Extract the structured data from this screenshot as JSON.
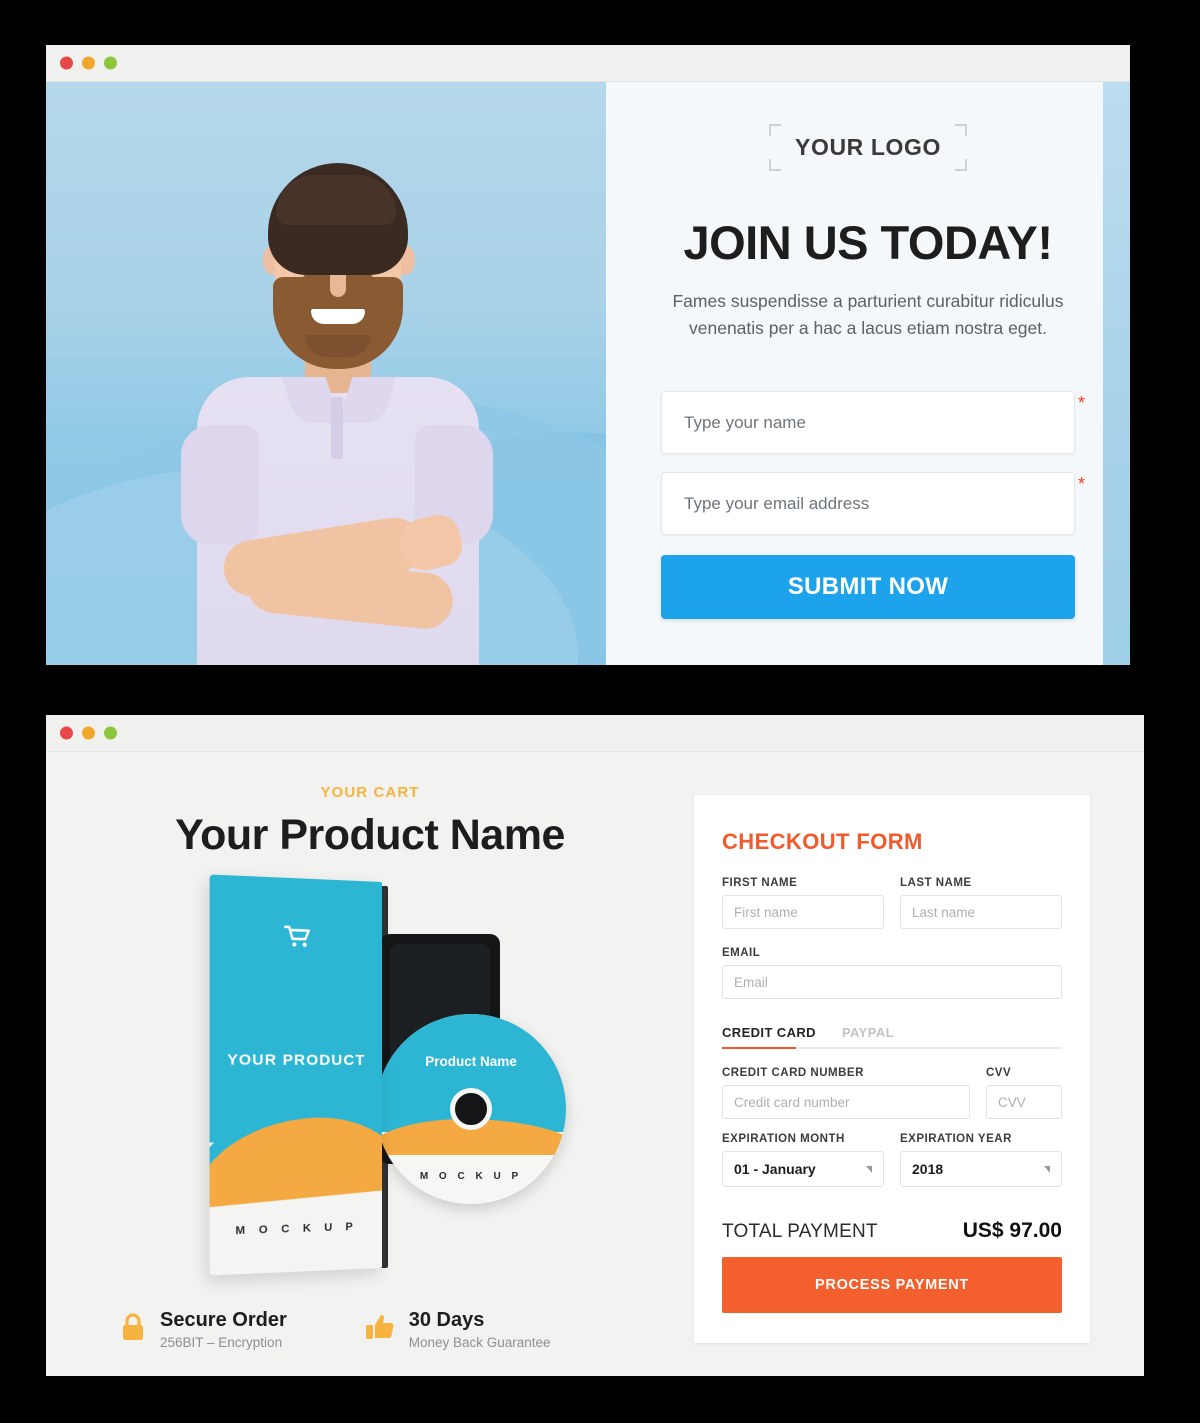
{
  "windows": {
    "top": {
      "traffic_lights": [
        "close",
        "minimize",
        "maximize"
      ],
      "hero": {
        "alt": "smiling bearded man in lavender polo shirt with arms crossed on light blue background"
      },
      "logo_placeholder": "YOUR LOGO",
      "headline": "JOIN US TODAY!",
      "subheadline": "Fames suspendisse a parturient curabitur ridiculus venenatis per a hac a lacus etiam nostra eget.",
      "form": {
        "fields": [
          {
            "name": "name",
            "placeholder": "Type your name",
            "required_mark": "*"
          },
          {
            "name": "email",
            "placeholder": "Type your email address",
            "required_mark": "*"
          }
        ],
        "submit_label": "SUBMIT NOW",
        "submit_color": "#1ca3ec"
      }
    },
    "bottom": {
      "traffic_lights": [
        "close",
        "minimize",
        "maximize"
      ],
      "cart": {
        "eyebrow": "YOUR CART",
        "eyebrow_color": "#f6b33f",
        "product_title": "Your Product Name",
        "mockup": {
          "box_front_label": "YOUR PRODUCT",
          "box_front_footer": "M O C K U P",
          "box_icon": "shopping-cart-icon",
          "disc_label": "Product Name",
          "disc_footer": "M O C K U P",
          "teal": "#2cb6d4",
          "orange": "#f5a942"
        },
        "badges": [
          {
            "icon": "lock-icon",
            "title": "Secure Order",
            "subtitle": "256BIT – Encryption"
          },
          {
            "icon": "thumbs-up-icon",
            "title": "30 Days",
            "subtitle": "Money Back Guarantee"
          }
        ]
      },
      "checkout": {
        "title": "CHECKOUT FORM",
        "title_color": "#f15a2b",
        "first_name": {
          "label": "FIRST NAME",
          "placeholder": "First name"
        },
        "last_name": {
          "label": "LAST NAME",
          "placeholder": "Last name"
        },
        "email": {
          "label": "EMAIL",
          "placeholder": "Email"
        },
        "tabs": [
          {
            "label": "CREDIT CARD",
            "active": true
          },
          {
            "label": "PAYPAL",
            "active": false
          }
        ],
        "card_number": {
          "label": "CREDIT CARD NUMBER",
          "placeholder": "Credit card number"
        },
        "cvv": {
          "label": "CVV",
          "placeholder": "CVV"
        },
        "expiration_month": {
          "label": "EXPIRATION MONTH",
          "value": "01 - January"
        },
        "expiration_year": {
          "label": "EXPIRATION YEAR",
          "value": "2018"
        },
        "total_label": "TOTAL PAYMENT",
        "total_value": "US$ 97.00",
        "pay_button": "PROCESS PAYMENT",
        "pay_button_color": "#f4602d"
      }
    }
  }
}
